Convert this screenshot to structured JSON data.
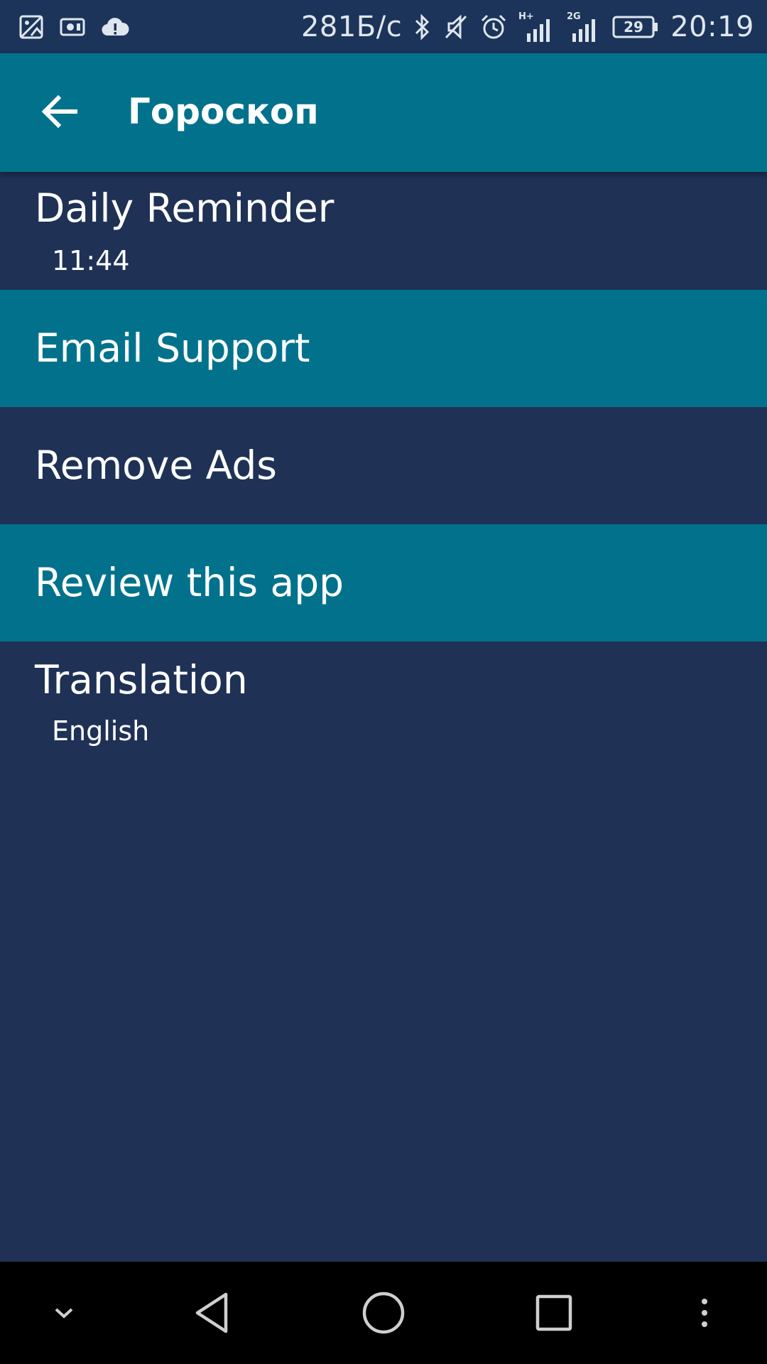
{
  "status_bar": {
    "net_speed": "281Б/с",
    "battery": "29",
    "time": "20:19",
    "network_1": "H+",
    "network_2": "2G",
    "icons": [
      "image-icon",
      "screen-record-icon",
      "cloud-alert-icon",
      "bluetooth-icon",
      "mute-icon",
      "alarm-icon",
      "signal-h-plus-icon",
      "signal-2g-icon",
      "battery-icon"
    ]
  },
  "app_bar": {
    "title": "Гороскоп",
    "back_icon": "arrow-back-icon"
  },
  "settings": {
    "items": [
      {
        "title": "Daily Reminder",
        "subtitle": "11:44"
      },
      {
        "title": "Email Support"
      },
      {
        "title": "Remove Ads"
      },
      {
        "title": "Review this app"
      },
      {
        "title": "Translation",
        "subtitle": "English"
      }
    ]
  },
  "nav_bar": {
    "icons": [
      "chevron-down-icon",
      "back-triangle-icon",
      "home-circle-icon",
      "recents-square-icon",
      "more-vertical-icon"
    ]
  },
  "colors": {
    "status_bar": "#1c3459",
    "app_bar": "#02728c",
    "row_dark": "#1f3155",
    "row_teal": "#02728c",
    "nav_bar": "#000000"
  }
}
